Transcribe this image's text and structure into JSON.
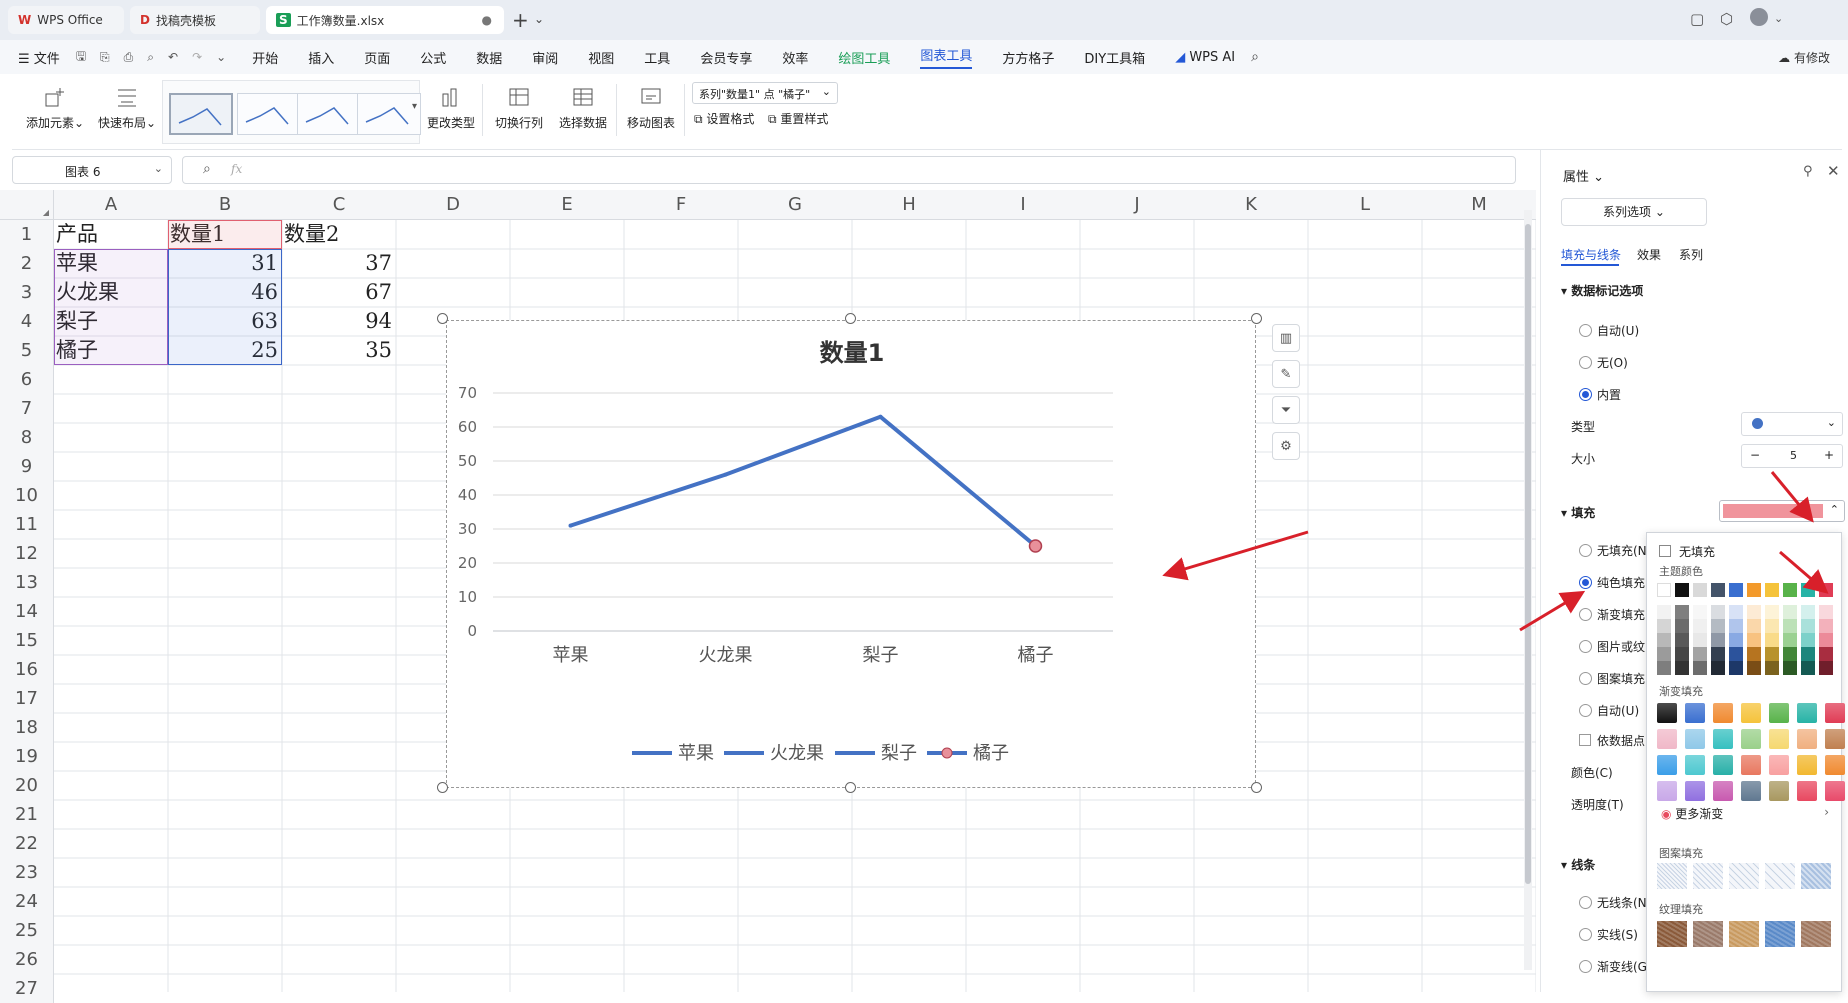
{
  "tabs": [
    {
      "label": "WPS Office",
      "icon": "wps-logo-icon"
    },
    {
      "label": "找稿壳模板",
      "icon": "template-logo-icon"
    },
    {
      "label": "工作簿数量.xlsx",
      "icon": "spreadsheet-logo-icon"
    }
  ],
  "menu": {
    "file": "文件",
    "items": [
      "开始",
      "插入",
      "页面",
      "公式",
      "数据",
      "审阅",
      "视图",
      "工具",
      "会员专享",
      "效率"
    ],
    "draw_tools": "绘图工具",
    "chart_tools": "图表工具",
    "extras": [
      "方方格子",
      "DIY工具箱"
    ],
    "wps_ai": "WPS AI",
    "has_changes": "有修改"
  },
  "ribbon": {
    "add_element": "添加元素",
    "quick_layout": "快速布局",
    "change_type": "更改类型",
    "switch_rowcol": "切换行列",
    "select_data": "选择数据",
    "move_chart": "移动图表",
    "series_select": "系列\"数量1\" 点 \"橘子\"",
    "set_format": "设置格式",
    "reset_style": "重置样式"
  },
  "formula": {
    "name_box": "图表 6",
    "fx": "fx"
  },
  "sheet": {
    "columns": [
      "A",
      "B",
      "C",
      "D",
      "E",
      "F",
      "G",
      "H",
      "I",
      "J",
      "K",
      "L",
      "M"
    ],
    "rows": [
      "1",
      "2",
      "3",
      "4",
      "5",
      "6",
      "7",
      "8",
      "9",
      "10",
      "11",
      "12",
      "13",
      "14",
      "15",
      "16",
      "17",
      "18",
      "19",
      "20",
      "21",
      "22",
      "23",
      "24",
      "25",
      "26",
      "27"
    ],
    "header": [
      "产品",
      "数量1",
      "数量2"
    ],
    "data": [
      [
        "苹果",
        "31",
        "37"
      ],
      [
        "火龙果",
        "46",
        "67"
      ],
      [
        "梨子",
        "63",
        "94"
      ],
      [
        "橘子",
        "25",
        "35"
      ]
    ]
  },
  "chart_data": {
    "type": "line",
    "title": "数量1",
    "categories": [
      "苹果",
      "火龙果",
      "梨子",
      "橘子"
    ],
    "series": [
      {
        "name": "数量1",
        "values": [
          31,
          46,
          63,
          25
        ],
        "color": "#4472c4"
      }
    ],
    "ylim": [
      0,
      70
    ],
    "yticks": [
      0,
      10,
      20,
      30,
      40,
      50,
      60,
      70
    ],
    "grid": true,
    "legend_position": "bottom",
    "legend_labels": [
      "苹果",
      "火龙果",
      "梨子",
      "橘子"
    ],
    "highlight_point": {
      "category": "橘子",
      "value": 25,
      "fill": "#e8909a"
    }
  },
  "pane": {
    "title": "属性",
    "series_options": "系列选项",
    "tabs": [
      "填充与线条",
      "效果",
      "系列"
    ],
    "marker_section": "数据标记选项",
    "marker_auto": "自动(U)",
    "marker_none": "无(O)",
    "marker_builtin": "内置",
    "type_label": "类型",
    "size_label": "大小",
    "size_value": "5",
    "fill_section": "填充",
    "fill_none": "无填充(N",
    "fill_solid": "纯色填充",
    "fill_gradient": "渐变填充",
    "fill_picture": "图片或纹",
    "fill_pattern": "图案填充",
    "fill_auto": "自动(U)",
    "fill_vary": "依数据点",
    "color_label": "颜色(C)",
    "transparency_label": "透明度(T)",
    "line_section": "线条",
    "line_none": "无线条(N",
    "line_solid": "实线(S)",
    "line_gradient": "渐变线(G",
    "fill_color": "#f0949c"
  },
  "popup": {
    "no_fill": "无填充",
    "theme_colors": "主题颜色",
    "gradient_fill": "渐变填充",
    "more_gradients": "更多渐变",
    "pattern_fill": "图案填充",
    "texture_fill": "纹理填充"
  }
}
